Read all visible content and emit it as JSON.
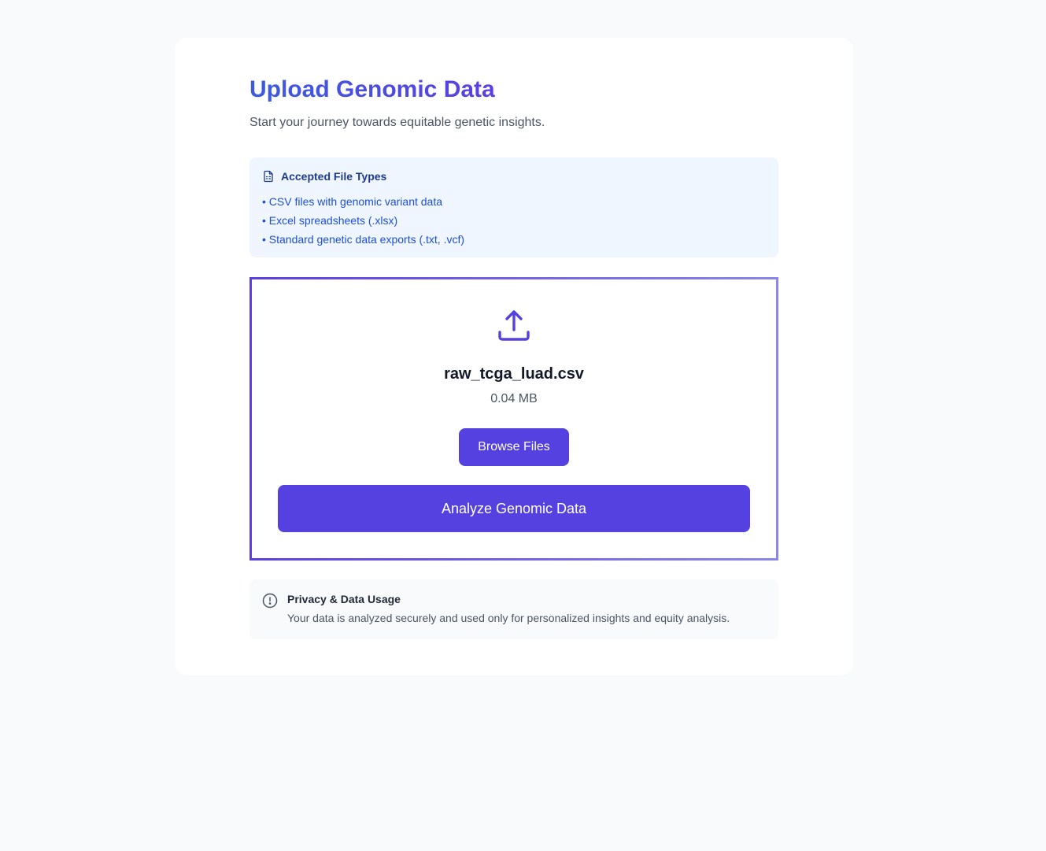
{
  "header": {
    "title": "Upload Genomic Data",
    "subtitle": "Start your journey towards equitable genetic insights."
  },
  "accepted_types": {
    "icon": "file-spreadsheet-icon",
    "title": "Accepted File Types",
    "items": [
      "• CSV files with genomic variant data",
      "• Excel spreadsheets (.xlsx)",
      "• Standard genetic data exports (.txt, .vcf)"
    ]
  },
  "dropzone": {
    "icon": "upload-icon",
    "file_name": "raw_tcga_luad.csv",
    "file_size": "0.04 MB",
    "browse_label": "Browse Files",
    "analyze_label": "Analyze Genomic Data"
  },
  "privacy": {
    "icon": "alert-circle-icon",
    "title": "Privacy & Data Usage",
    "text": "Your data is analyzed securely and used only for personalized insights and equity analysis."
  },
  "colors": {
    "accent": "#5540e0",
    "title_gradient_start": "#3b5be0",
    "title_gradient_end": "#5b3fe0",
    "info_bg": "#eff6ff",
    "info_text": "#1d4ed8"
  }
}
